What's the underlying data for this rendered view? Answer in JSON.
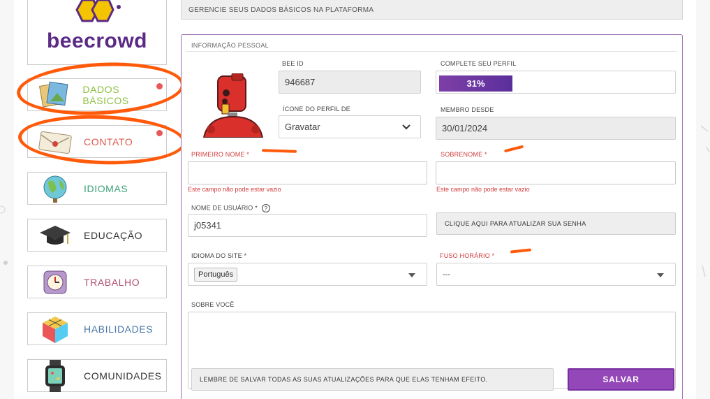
{
  "brand": {
    "name": "beecrowd",
    "color": "#5b2a86"
  },
  "sidebar": {
    "items": [
      {
        "label": "DADOS BÁSICOS",
        "icon": "photos-icon",
        "color": "#8cbf3f",
        "badge": true
      },
      {
        "label": "CONTATO",
        "icon": "envelope-icon",
        "color": "#e0584e",
        "badge": true
      },
      {
        "label": "IDIOMAS",
        "icon": "globe-icon",
        "color": "#3aa37a",
        "badge": false
      },
      {
        "label": "EDUCAÇÃO",
        "icon": "graduation-cap-icon",
        "color": "#333333",
        "badge": false
      },
      {
        "label": "TRABALHO",
        "icon": "alarm-clock-icon",
        "color": "#b0506e",
        "badge": false
      },
      {
        "label": "HABILIDADES",
        "icon": "cube-icon",
        "color": "#4a77a8",
        "badge": false
      },
      {
        "label": "COMUNIDADES",
        "icon": "smartwatch-icon",
        "color": "#333333",
        "badge": false
      }
    ]
  },
  "header": {
    "subtitle": "GERENCIE SEUS DADOS BÁSICOS NA PLATAFORMA"
  },
  "form": {
    "section_title": "INFORMAÇÃO PESSOAL",
    "bee_id_label": "BEE ID",
    "bee_id_value": "946687",
    "complete_label": "COMPLETE SEU PERFIL",
    "complete_value": "31%",
    "complete_fraction": 0.31,
    "avatar_icon_label": "ÍCONE DO PERFIL DE",
    "avatar_icon_value": "Gravatar",
    "member_since_label": "MEMBRO DESDE",
    "member_since_value": "30/01/2024",
    "first_name_label": "PRIMEIRO NOME *",
    "first_name_value": "",
    "first_name_error": "Este campo não pode estar vazio",
    "last_name_label": "SOBRENOME *",
    "last_name_value": "",
    "last_name_error": "Este campo não pode estar vazio",
    "username_label": "NOME DE USUÁRIO *",
    "username_help": "?",
    "username_value": "j05341",
    "password_button": "CLIQUE AQUI PARA ATUALIZAR SUA SENHA",
    "site_language_label": "IDIOMA DO SITE *",
    "site_language_value": "Português",
    "timezone_label": "FUSO HORÁRIO *",
    "timezone_value": "---",
    "about_label": "SOBRE VOCÊ",
    "about_value": "",
    "save_reminder": "LEMBRE DE SALVAR TODAS AS SUAS ATUALIZAÇÕES PARA QUE ELAS TENHAM EFEITO.",
    "save_button": "SALVAR"
  },
  "colors": {
    "accent": "#9447b8",
    "error": "#d23c3c",
    "annotation": "#ff5a0a"
  }
}
